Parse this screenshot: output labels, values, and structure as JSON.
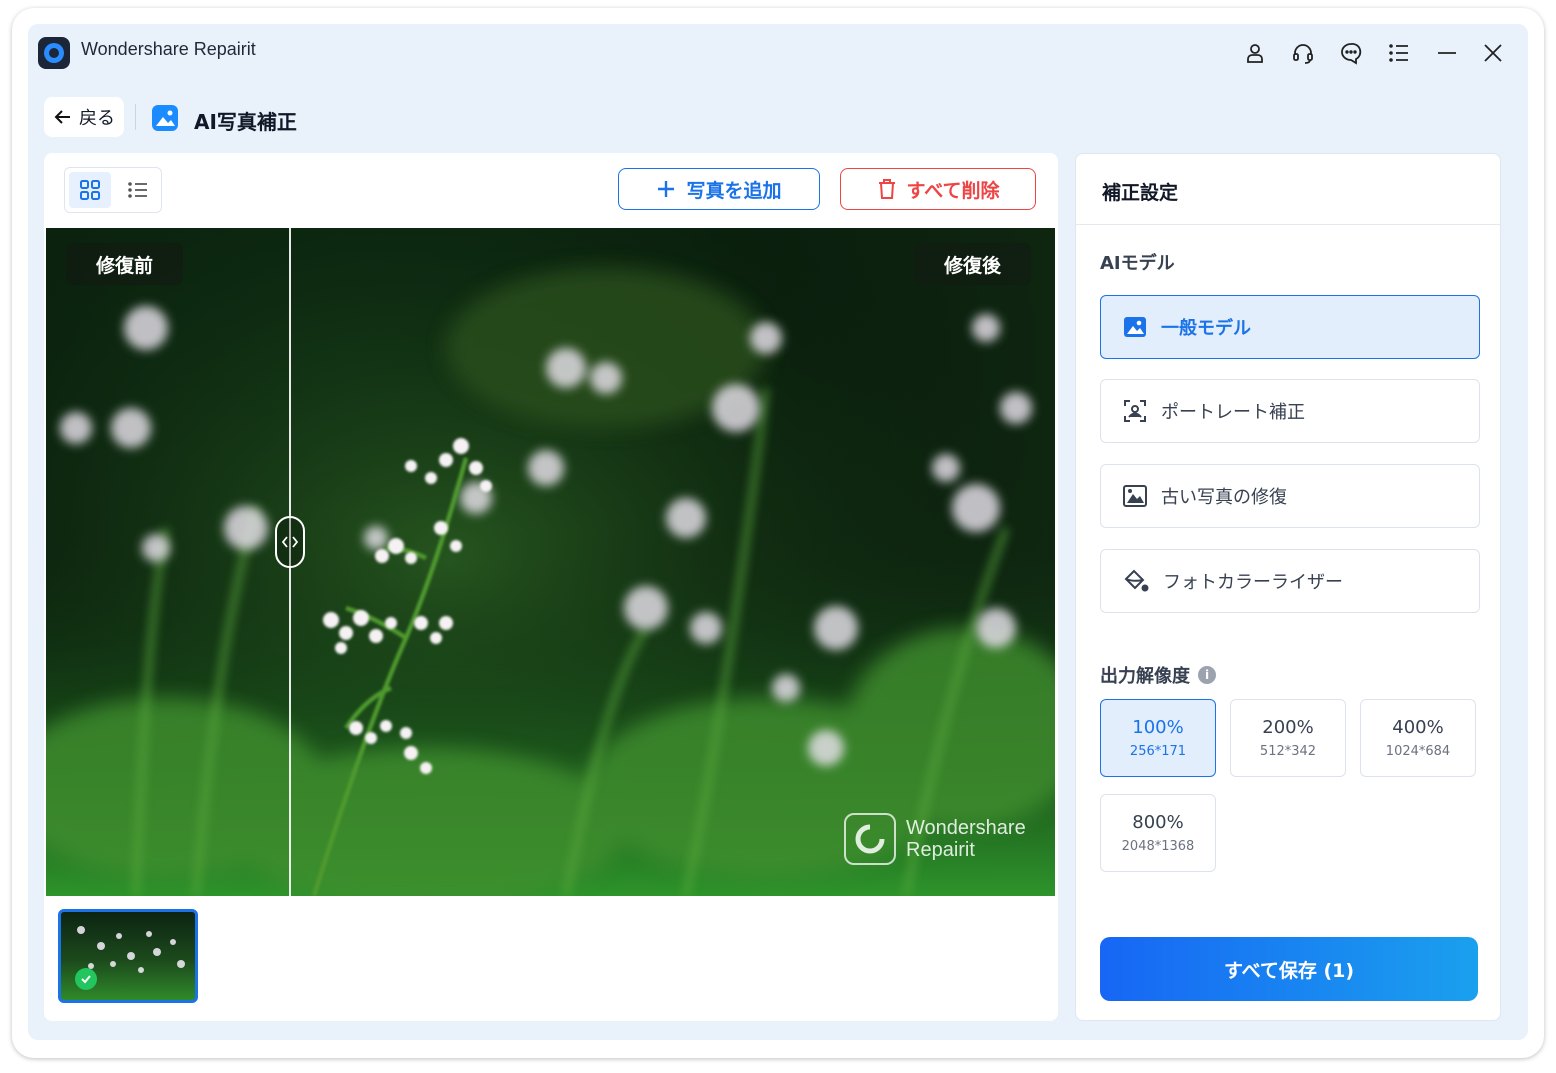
{
  "app": {
    "title": "Wondershare Repairit"
  },
  "nav": {
    "back_label": "戻る",
    "section_title": "AI写真補正"
  },
  "toolbar": {
    "add_photo_label": "写真を追加",
    "delete_all_label": "すべて削除"
  },
  "preview": {
    "before_label": "修復前",
    "after_label": "修復後",
    "watermark_line1": "Wondershare",
    "watermark_line2": "Repairit"
  },
  "settings": {
    "title": "補正設定",
    "ai_model_label": "AIモデル",
    "models": [
      {
        "label": "一般モデル",
        "icon": "image-icon",
        "selected": true
      },
      {
        "label": "ポートレート補正",
        "icon": "portrait-scan-icon",
        "selected": false
      },
      {
        "label": "古い写真の修復",
        "icon": "old-photo-icon",
        "selected": false
      },
      {
        "label": "フォトカラーライザー",
        "icon": "paint-bucket-icon",
        "selected": false
      }
    ],
    "resolution_label": "出力解像度",
    "resolutions": [
      {
        "percent": "100%",
        "size": "256*171",
        "selected": true
      },
      {
        "percent": "200%",
        "size": "512*342",
        "selected": false
      },
      {
        "percent": "400%",
        "size": "1024*684",
        "selected": false
      },
      {
        "percent": "800%",
        "size": "2048*1368",
        "selected": false
      }
    ],
    "save_all_label": "すべて保存 (1)"
  },
  "colors": {
    "accent": "#1a73e8",
    "danger": "#ef4444",
    "window_bg": "#e9f1fb",
    "success": "#22c55e"
  }
}
